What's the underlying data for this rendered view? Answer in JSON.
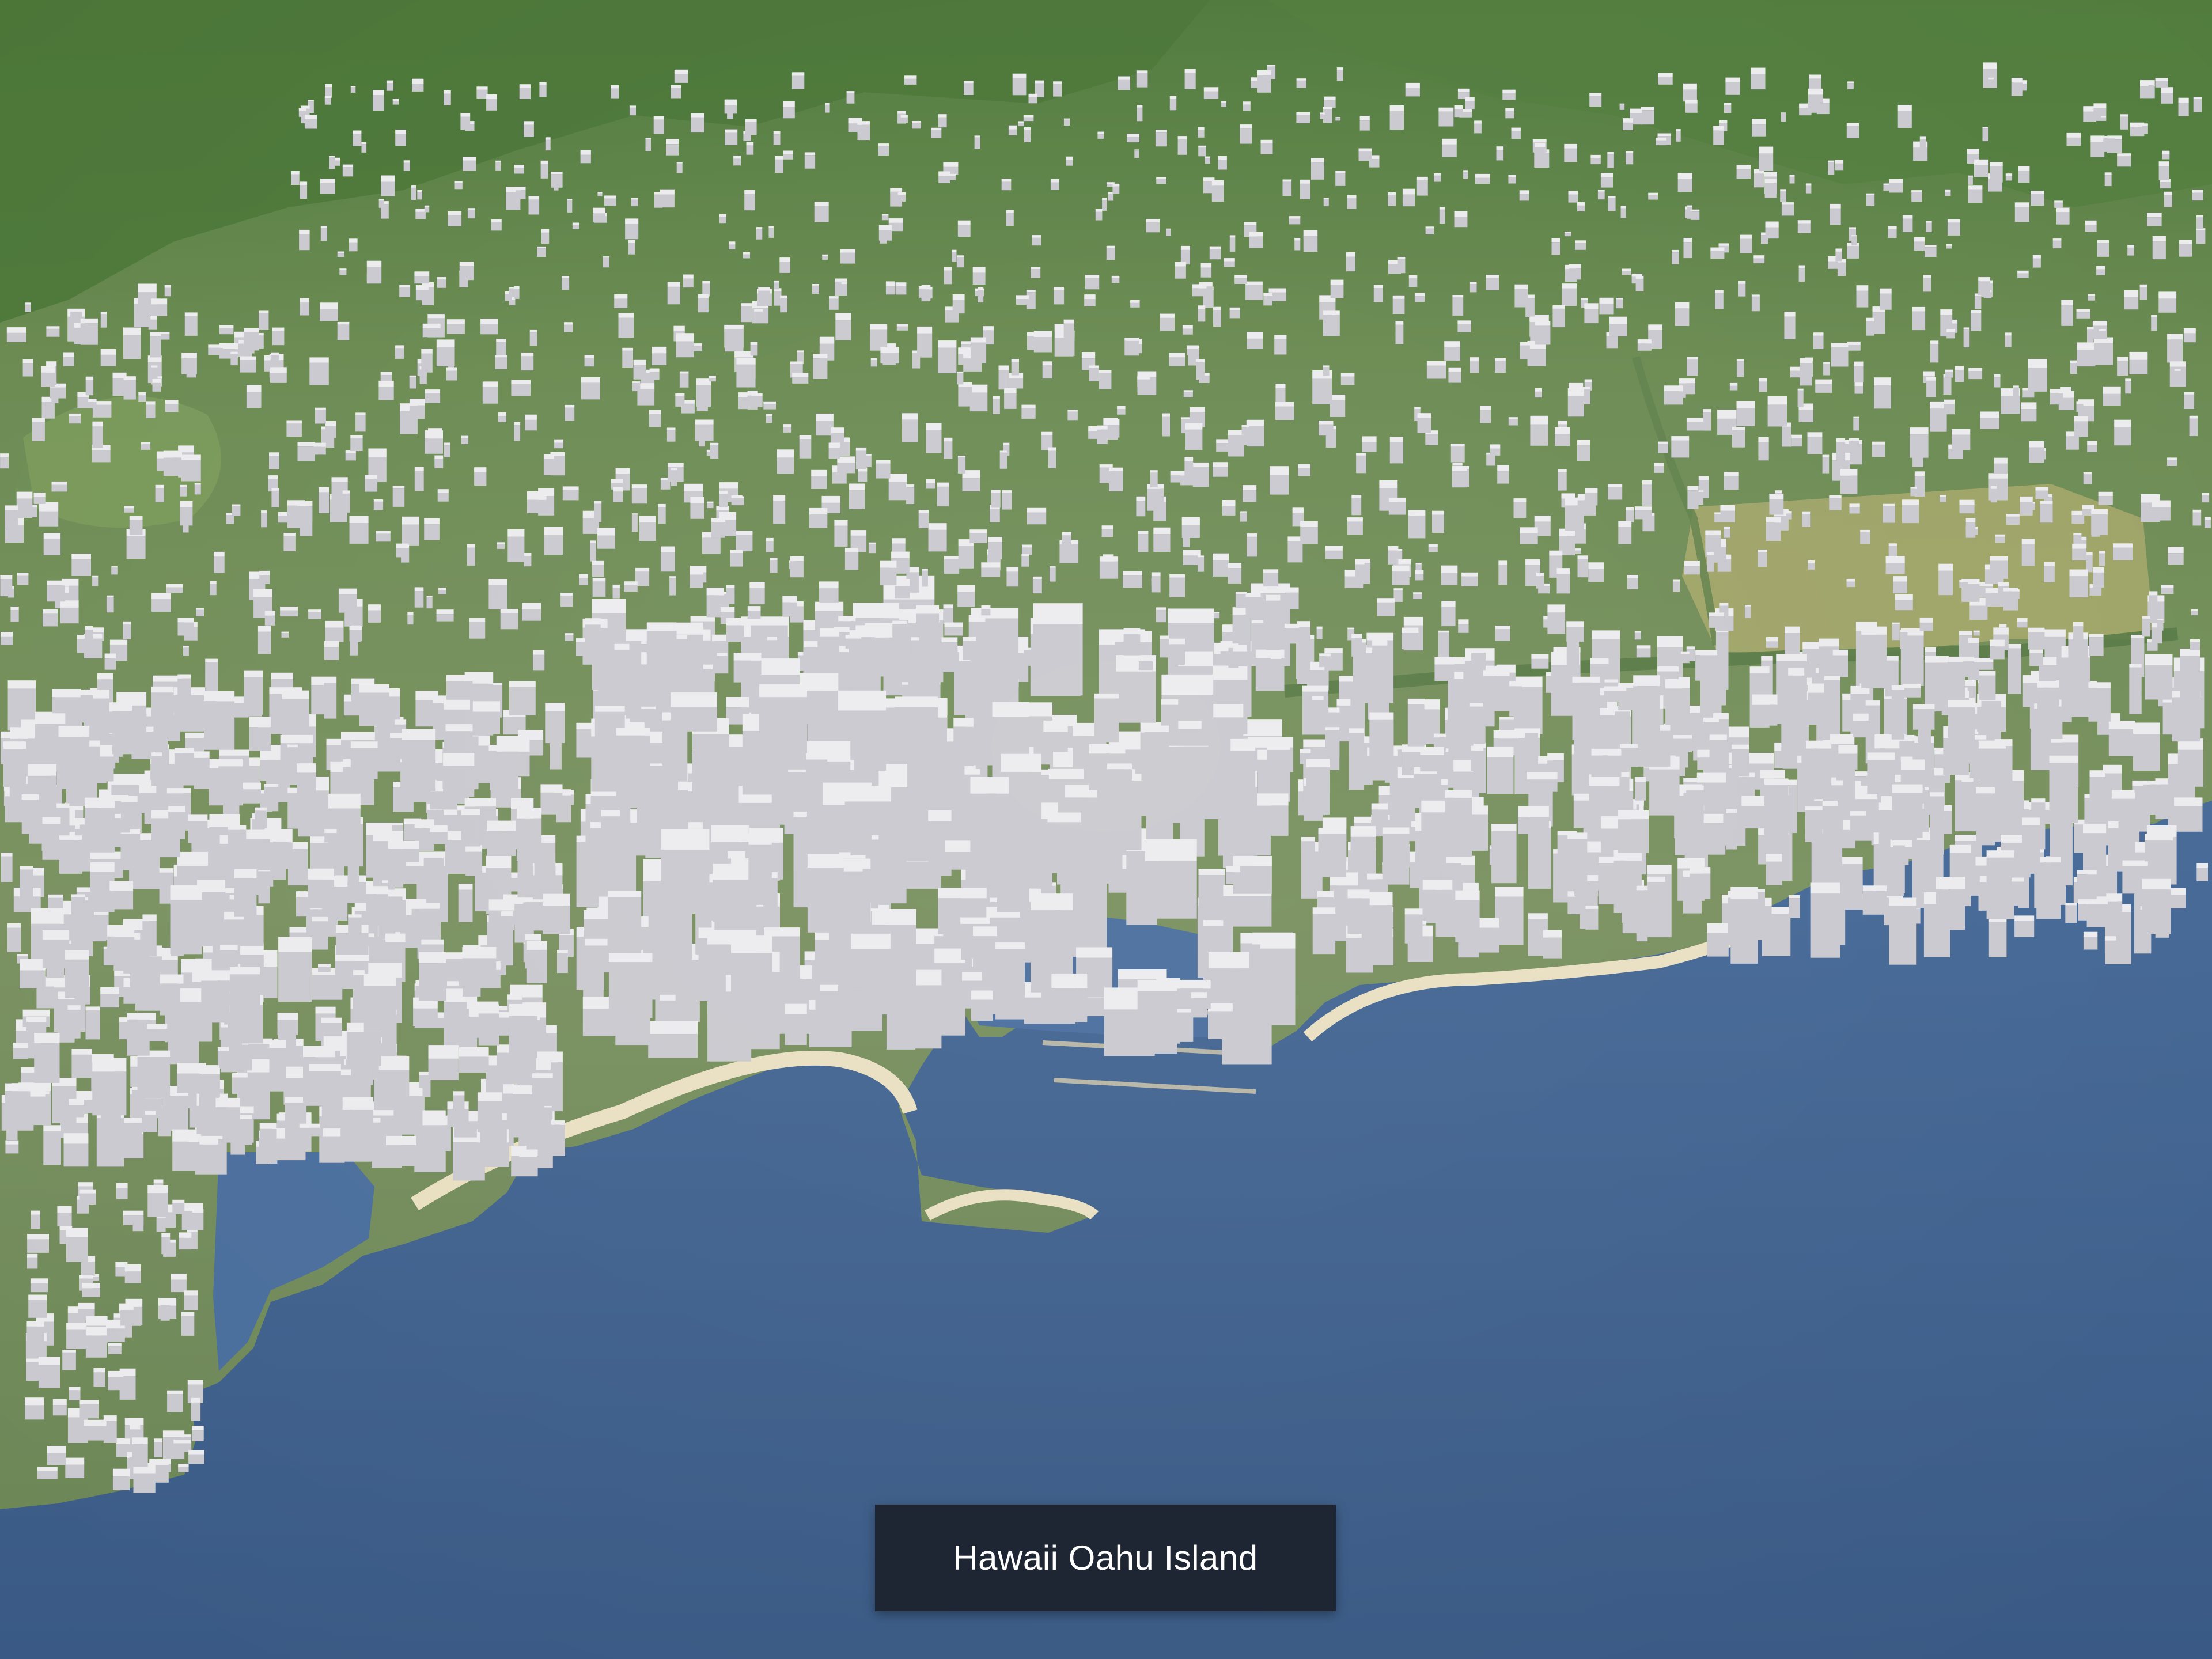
{
  "map": {
    "caption": "Hawaii Oahu Island",
    "colors": {
      "ocean": "#476a98",
      "ocean_deep": "#3e5f8b",
      "land": "#6f8d55",
      "mountain": "#4f7a3c",
      "buildings": "#e6e6e9",
      "beach": "#e9dfc1",
      "caption_bg": "#1f2633",
      "caption_text": "#ffffff"
    }
  }
}
